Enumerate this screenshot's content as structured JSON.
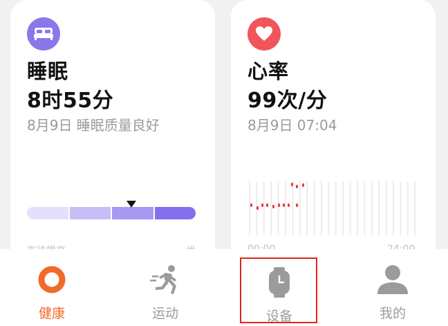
{
  "colors": {
    "accent": "#f06a2a",
    "sleep": "#8b76ea",
    "heart": "#f1555c",
    "inactive": "#9b9b9b",
    "highlight": "#e5231e"
  },
  "cards": {
    "sleep": {
      "icon": "bed-icon",
      "title": "睡眠",
      "value": "8时55分",
      "subtitle": "8月9日 睡眠质量良好",
      "quality_segments": [
        "#e4e0fb",
        "#c8bef7",
        "#a898f1",
        "#8370ec"
      ],
      "quality_level": 0.62,
      "footer_left": "有待提高",
      "footer_right": "优"
    },
    "heart": {
      "icon": "heart-icon",
      "title": "心率",
      "value": "99次/分",
      "subtitle": "8月9日 07:04",
      "axis_left": "00:00",
      "axis_right": "24:00"
    }
  },
  "tabs": [
    {
      "label": "健康",
      "icon": "health-ring-icon",
      "active": true
    },
    {
      "label": "运动",
      "icon": "running-icon",
      "active": false
    },
    {
      "label": "设备",
      "icon": "watch-icon",
      "active": false
    },
    {
      "label": "我的",
      "icon": "user-icon",
      "active": false
    }
  ]
}
